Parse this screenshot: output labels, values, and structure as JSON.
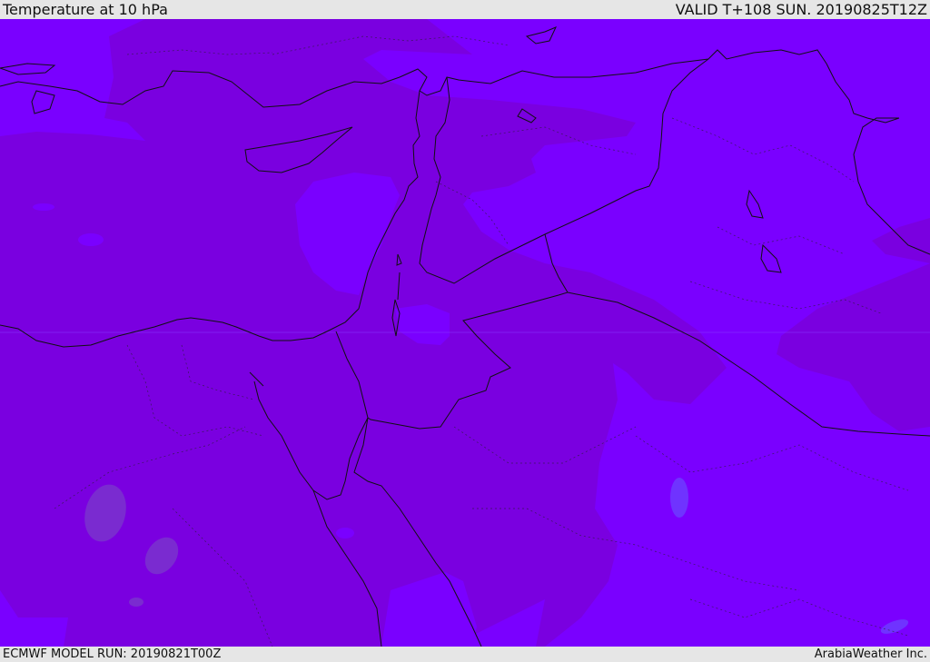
{
  "header": {
    "title": "Temperature at 10 hPa",
    "valid": "VALID T+108 SUN. 20190825T12Z"
  },
  "footer": {
    "model_run": "ECMWF MODEL RUN: 20190821T00Z",
    "credit": "ArabiaWeather Inc."
  },
  "map": {
    "region": "Eastern Mediterranean / Middle East",
    "field": "temperature",
    "colors": {
      "warm_shade": "#7a00e0",
      "cool_shade": "#7a00ff",
      "anomaly_spot": "#7a2bd0",
      "border_line": "#111111"
    }
  }
}
